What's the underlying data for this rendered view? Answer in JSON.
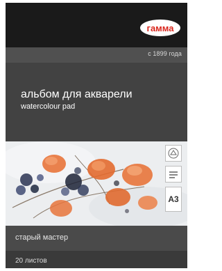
{
  "brand": {
    "logo_text": "гамма",
    "since": "с 1899 года"
  },
  "product": {
    "title_ru": "альбом для акварели",
    "title_en": "watercolour pad",
    "series": "старый мастер",
    "sheets": "20 листов",
    "format_badge": "A3"
  },
  "colors": {
    "cover_dark": "#1a1a1a",
    "cover_grey": "#424242",
    "logo_red": "#d9261c",
    "flower_orange": "#e8743b"
  },
  "icons": [
    "brand-logo-icon",
    "paper-weight-icon",
    "cotton-icon",
    "watercolor-illustration"
  ]
}
